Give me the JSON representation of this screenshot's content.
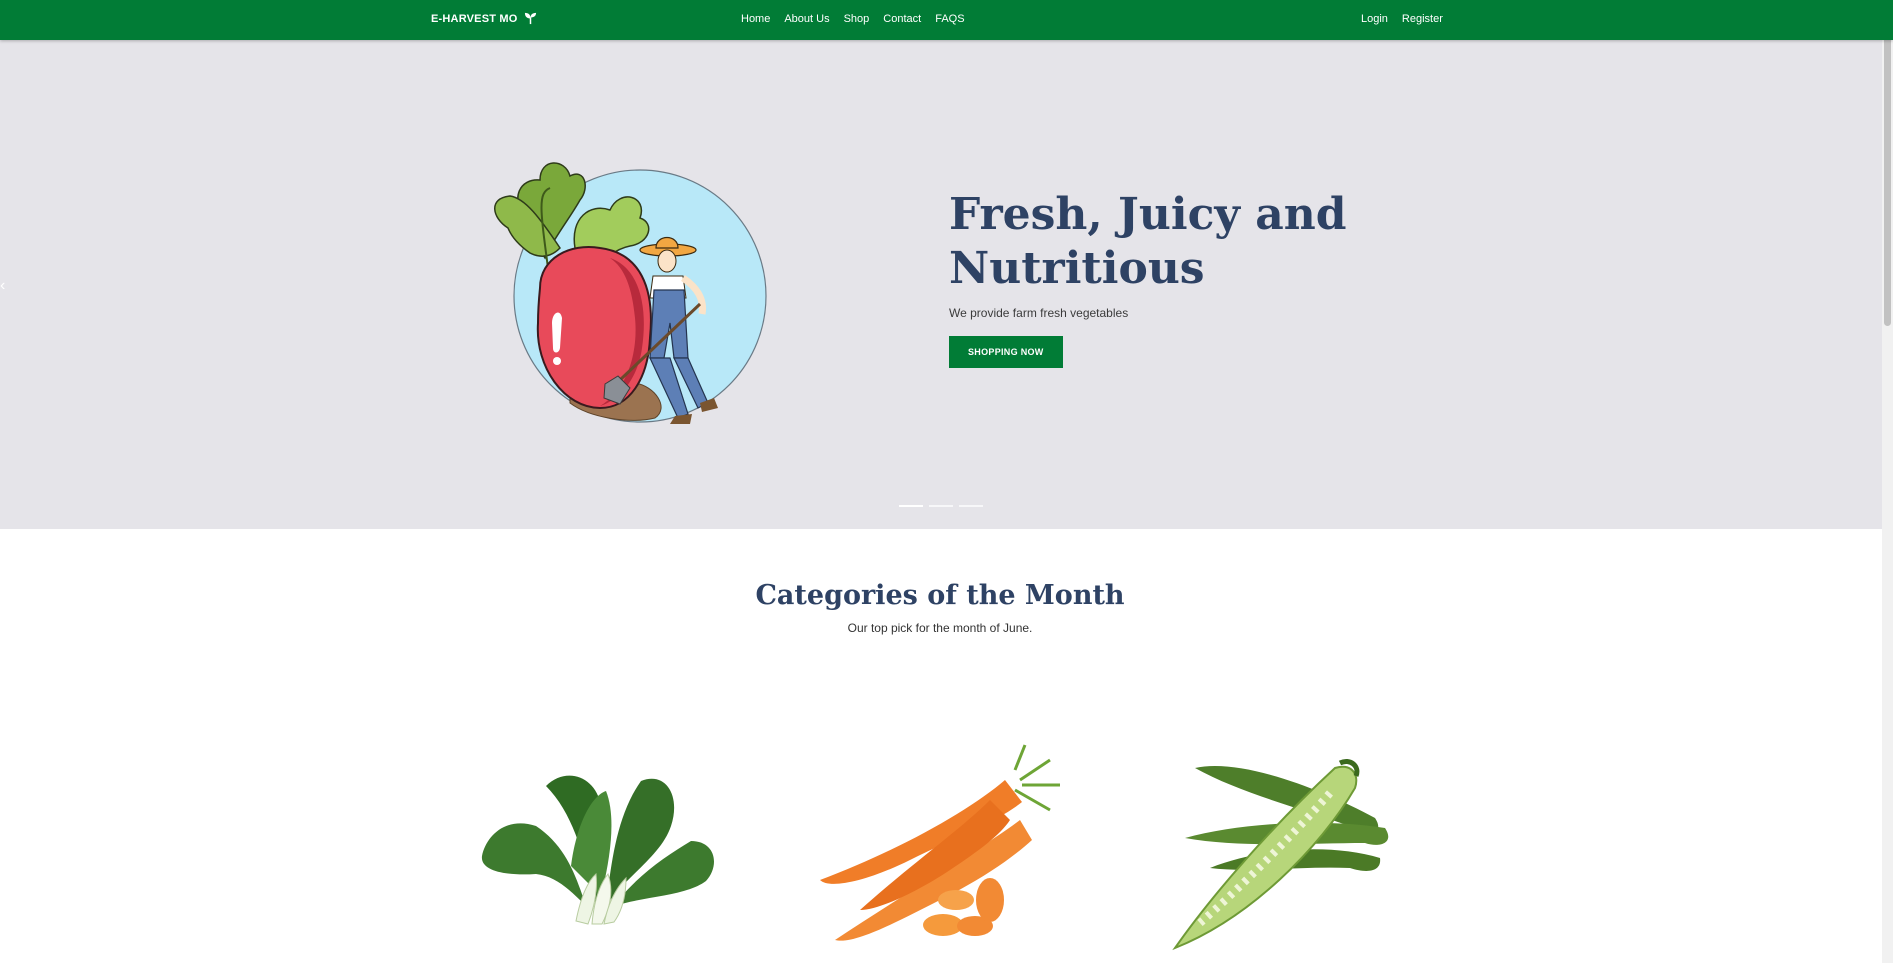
{
  "nav": {
    "brand": "E-HARVEST MO",
    "links": [
      "Home",
      "About Us",
      "Shop",
      "Contact",
      "FAQS"
    ],
    "login": "Login",
    "register": "Register"
  },
  "hero": {
    "title_line1": "Fresh, Juicy and",
    "title_line2": "Nutritious",
    "subtitle": "We provide farm fresh vegetables",
    "button": "SHOPPING NOW",
    "slides": 3,
    "active_slide": 1
  },
  "categories": {
    "title": "Categories of the Month",
    "subtitle": "Our top pick for the month of June.",
    "items": [
      "bok-choy",
      "carrots",
      "okra"
    ]
  },
  "colors": {
    "brand_green": "#017c36",
    "hero_bg": "#e5e4e9",
    "heading": "#2e4264"
  }
}
